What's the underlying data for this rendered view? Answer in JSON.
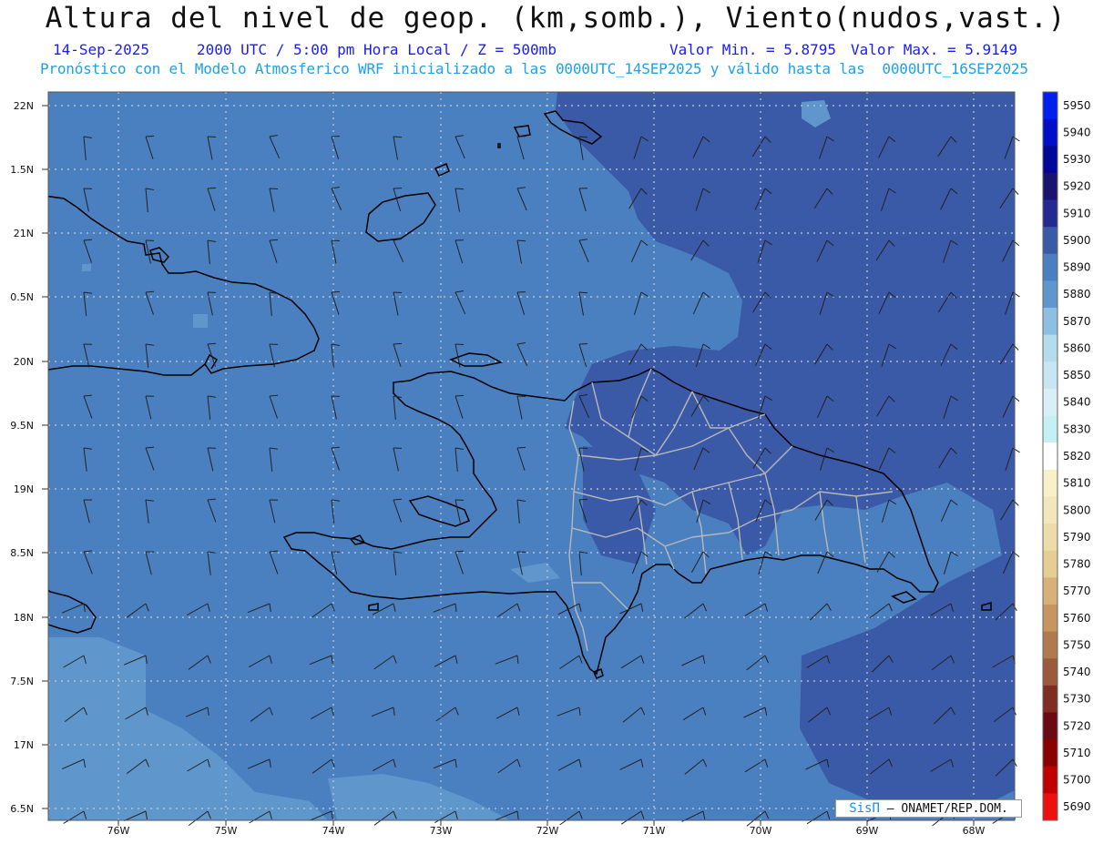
{
  "header": {
    "title": "Altura del nivel de geop. (km,somb.), Viento(nudos,vast.)",
    "date": "14-Sep-2025",
    "time": "2000 UTC / 5:00 pm Hora Local / Z = 500mb",
    "min_label": "Valor Min. = 5.8795",
    "max_label": "Valor Max. = 5.9149",
    "forecast": "Pronóstico con el Modelo Atmosferico WRF inicializado a las 0000UTC_14SEP2025 y válido hasta las  0000UTC_16SEP2025"
  },
  "map": {
    "lat_labels": [
      "22N",
      "1.5N",
      "21N",
      "0.5N",
      "20N",
      "9.5N",
      "19N",
      "8.5N",
      "18N",
      "7.5N",
      "17N",
      "6.5N"
    ],
    "lon_labels": [
      "76W",
      "75W",
      "74W",
      "73W",
      "72W",
      "71W",
      "70W",
      "69W",
      "68W"
    ],
    "region": "Hispaniola",
    "fill_colors": {
      "5880": "#5f97cd",
      "5890": "#4a80c0",
      "5900": "#3a59a6"
    }
  },
  "colorbar": {
    "levels": [
      "5950",
      "5940",
      "5930",
      "5920",
      "5910",
      "5900",
      "5890",
      "5880",
      "5870",
      "5860",
      "5850",
      "5840",
      "5830",
      "5820",
      "5810",
      "5800",
      "5790",
      "5780",
      "5770",
      "5760",
      "5750",
      "5740",
      "5730",
      "5720",
      "5710",
      "5700",
      "5690"
    ],
    "colors": [
      "#0020f0",
      "#0010c8",
      "#00089a",
      "#1a1470",
      "#252a8e",
      "#3a59a6",
      "#4a80c0",
      "#5f97cd",
      "#8fbfe0",
      "#b4dcec",
      "#c8e6f2",
      "#d8eff7",
      "#c4f0f4",
      "#ffffff",
      "#f8f0c8",
      "#f2e6bc",
      "#ecdcaa",
      "#e6cd94",
      "#d8b07a",
      "#c79560",
      "#b07a4e",
      "#9a5a3c",
      "#7f2e24",
      "#6a0a12",
      "#8a0000",
      "#c00000",
      "#ee1010"
    ]
  },
  "credit": {
    "brand": "SisΠ",
    "text": " – ONAMET/REP.DOM."
  }
}
